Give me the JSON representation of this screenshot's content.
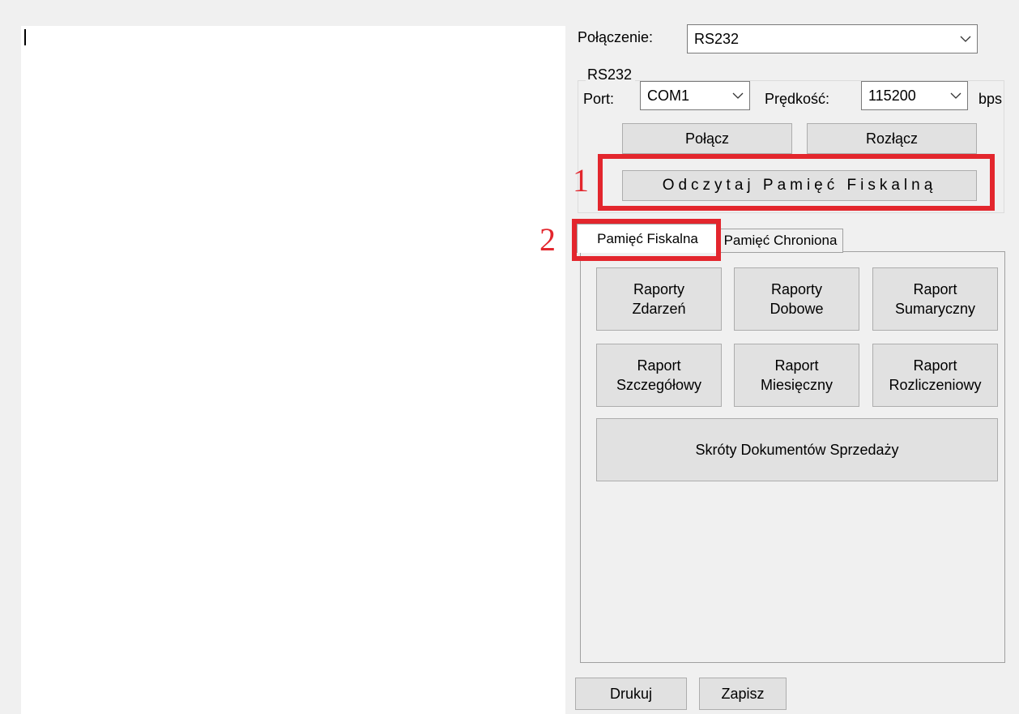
{
  "connection": {
    "label": "Połączenie:",
    "value": "RS232"
  },
  "rs232": {
    "title": "RS232",
    "port_label": "Port:",
    "port_value": "COM1",
    "speed_label": "Prędkość:",
    "speed_value": "115200",
    "speed_unit": "bps",
    "connect_label": "Połącz",
    "disconnect_label": "Rozłącz",
    "read_fiscal_label": "Odczytaj Pamięć Fiskalną"
  },
  "annotations": {
    "marker1": "1",
    "marker2": "2",
    "color": "#e3262d"
  },
  "tabs": {
    "fiscal": "Pamięć Fiskalna",
    "protected": "Pamięć Chroniona"
  },
  "reports": {
    "events": "Raporty\nZdarzeń",
    "daily": "Raporty\nDobowe",
    "summary": "Raport\nSumaryczny",
    "detailed": "Raport\nSzczegółowy",
    "monthly": "Raport\nMiesięczny",
    "settlement": "Raport\nRozliczeniowy",
    "sales_docs": "Skróty Dokumentów Sprzedaży"
  },
  "footer": {
    "print_label": "Drukuj",
    "save_label": "Zapisz"
  },
  "icons": {
    "dropdown": "chevron-down-icon"
  }
}
